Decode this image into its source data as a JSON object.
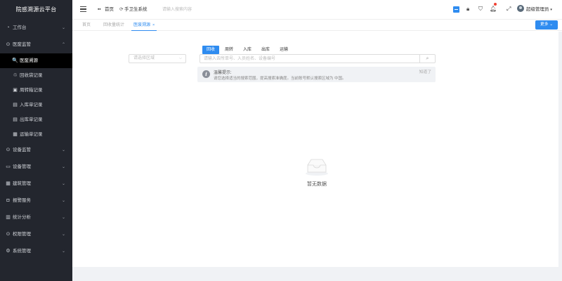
{
  "app_title": "院感溯源云平台",
  "sidebar": {
    "items": [
      {
        "label": "工作台",
        "icon": "dashboard-icon",
        "glyph": "◔",
        "expanded": false
      },
      {
        "label": "医废监管",
        "icon": "shield-icon",
        "glyph": "⊙",
        "expanded": true,
        "children": [
          {
            "label": "医废溯源",
            "icon": "search-icon",
            "glyph": "🔍",
            "active": true
          },
          {
            "label": "回收袋记录",
            "icon": "bag-icon",
            "glyph": "♲",
            "active": false
          },
          {
            "label": "周转箱记录",
            "icon": "box-icon",
            "glyph": "▣",
            "active": false
          },
          {
            "label": "入库单记录",
            "icon": "inbound-icon",
            "glyph": "▤",
            "active": false
          },
          {
            "label": "出库单记录",
            "icon": "outbound-icon",
            "glyph": "▤",
            "active": false
          },
          {
            "label": "运输单记录",
            "icon": "truck-icon",
            "glyph": "▦",
            "active": false
          }
        ]
      },
      {
        "label": "设备监管",
        "icon": "device-monitor-icon",
        "glyph": "⊙",
        "expanded": false
      },
      {
        "label": "设备管理",
        "icon": "device-manage-icon",
        "glyph": "▭",
        "expanded": false
      },
      {
        "label": "建筑管理",
        "icon": "building-icon",
        "glyph": "▦",
        "expanded": false
      },
      {
        "label": "报警服务",
        "icon": "alarm-icon",
        "glyph": "◘",
        "expanded": false
      },
      {
        "label": "统计分析",
        "icon": "chart-icon",
        "glyph": "▥",
        "expanded": false
      },
      {
        "label": "权限管理",
        "icon": "lock-icon",
        "glyph": "⊙",
        "expanded": false
      },
      {
        "label": "系统管理",
        "icon": "settings-icon",
        "glyph": "⚙",
        "expanded": false
      }
    ]
  },
  "header": {
    "breadcrumb_home": "首页",
    "breadcrumb_current": "手卫生系统",
    "search_placeholder": "请输入搜索内容",
    "user_name": "超级管理员",
    "notification_dot_color": "#f04134"
  },
  "tabs": [
    {
      "label": "首页",
      "active": false
    },
    {
      "label": "回收量统计",
      "active": false
    },
    {
      "label": "医废溯源",
      "active": true,
      "closable": true
    }
  ],
  "more_button": "更多",
  "filters": {
    "region_placeholder": "请选择区域",
    "search_tabs": [
      "回收",
      "周转",
      "入库",
      "出库",
      "运输"
    ],
    "active_search_tab": 0,
    "search_placeholder": "请输入去所单号、入员姓名、设备编号"
  },
  "tip": {
    "title": "温馨提示:",
    "text": "请您选择适当的搜索范围，提高搜索准确度。当前账号默认搜索区域为 中国。",
    "close_label": "知道了"
  },
  "empty_text": "暂无数据",
  "colors": {
    "accent": "#2f8cf0",
    "sidebar_bg": "#23262e",
    "sidebar_active_bg": "#000000"
  }
}
